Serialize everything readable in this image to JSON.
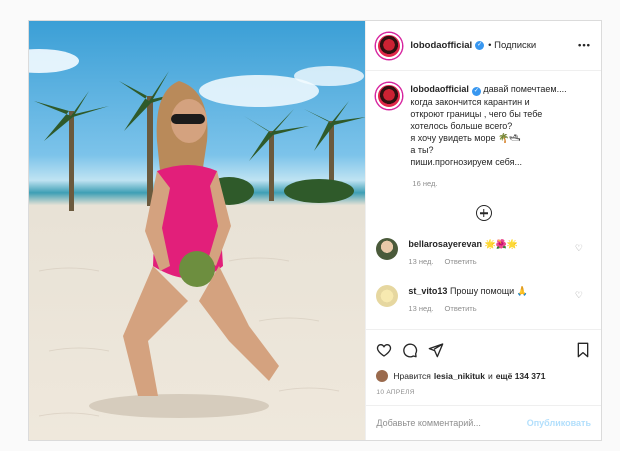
{
  "post": {
    "username": "lobodaofficial",
    "follow_label": "• Подписки",
    "more_label": "•••",
    "caption_lines": [
      "давай помечтаем....",
      "когда закончится карантин и",
      "откроют границы , чего бы тебе",
      "хотелось больше всего?",
      "я хочу увидеть море 🌴🛥",
      "а ты?",
      "пиши.прогнозируем себя..."
    ],
    "caption_time": "16 нед.",
    "comments": [
      {
        "username": "bellarosayerevan",
        "text": "🌟🌺🌟",
        "time": "13 нед.",
        "reply": "Ответить"
      },
      {
        "username": "st_vito13",
        "text": "Прошу помощи 🙏",
        "time": "13 нед.",
        "reply": "Ответить"
      }
    ],
    "likes": {
      "prefix": "Нравится",
      "user": "lesia_nikituk",
      "middle": "и",
      "count": "ещё 134 371"
    },
    "date": "10 АПРЕЛЯ",
    "add_comment_placeholder": "Добавьте комментарий...",
    "publish_label": "Опубликовать",
    "icons": [
      "heart-icon",
      "comment-icon",
      "share-icon",
      "bookmark-icon",
      "add-icon",
      "more-icon",
      "verified-icon"
    ]
  }
}
